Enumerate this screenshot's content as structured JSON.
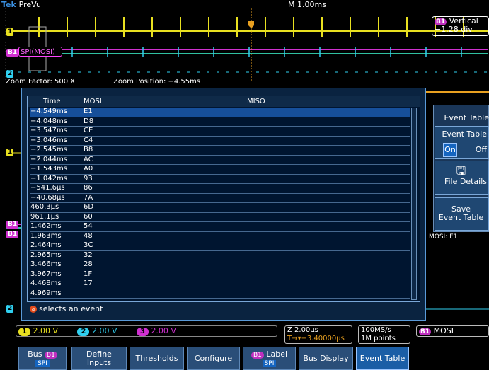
{
  "header": {
    "brand_prefix": "Tek",
    "brand_mode": "PreVu",
    "timebase": "M 1.00ms"
  },
  "zoom": {
    "factor_text": "Zoom Factor: 500 X",
    "position_text": "Zoom Position: −4.55ms"
  },
  "vertical_box": {
    "badge": "B1",
    "line1": "Vertical",
    "line2": "−1.28 div"
  },
  "bus_label": "SPI(MOSI)",
  "table": {
    "headers": {
      "time": "Time",
      "mosi": "MOSI",
      "miso": "MISO"
    },
    "rows": [
      {
        "time": "−4.549ms",
        "mosi": "E1"
      },
      {
        "time": "−4.048ms",
        "mosi": "D8"
      },
      {
        "time": "−3.547ms",
        "mosi": "CE"
      },
      {
        "time": "−3.046ms",
        "mosi": "C4"
      },
      {
        "time": "−2.545ms",
        "mosi": "B8"
      },
      {
        "time": "−2.044ms",
        "mosi": "AC"
      },
      {
        "time": "−1.543ms",
        "mosi": "A0"
      },
      {
        "time": "−1.042ms",
        "mosi": "93"
      },
      {
        "time": "−541.6µs",
        "mosi": "86"
      },
      {
        "time": "−40.68µs",
        "mosi": "7A"
      },
      {
        "time": "460.3µs",
        "mosi": "6D"
      },
      {
        "time": "961.1µs",
        "mosi": "60"
      },
      {
        "time": "1.462ms",
        "mosi": "54"
      },
      {
        "time": "1.963ms",
        "mosi": "48"
      },
      {
        "time": "2.464ms",
        "mosi": "3C"
      },
      {
        "time": "2.965ms",
        "mosi": "32"
      },
      {
        "time": "3.466ms",
        "mosi": "28"
      },
      {
        "time": "3.967ms",
        "mosi": "1F"
      },
      {
        "time": "4.468ms",
        "mosi": "17"
      },
      {
        "time": "4.969ms",
        "mosi": ""
      }
    ],
    "hint_knob": "a",
    "hint_text": "selects an event"
  },
  "side_menu": {
    "title": "Event Table",
    "toggle_label": "Event Table",
    "on_label": "On",
    "off_label": "Off",
    "file_details": "File Details",
    "save_line1": "Save",
    "save_line2": "Event Table",
    "mosi_readout": "MOSI: E1"
  },
  "status": {
    "ch1": "1",
    "ch1_value": "2.00 V",
    "ch2": "2",
    "ch2_value": "2.00 V",
    "ch3": "3",
    "ch3_value": "2.00 V",
    "zoom_time": "Z 2.00µs",
    "trigger": "T→▾−3.40000µs",
    "sample_rate": "100MS/s",
    "record_length": "1M points",
    "bus_badge": "B1",
    "bus_name": "MOSI"
  },
  "menu": {
    "bus_label": "Bus",
    "bus_badge": "B1",
    "bus_tag": "SPI",
    "define_inputs_1": "Define",
    "define_inputs_2": "Inputs",
    "thresholds": "Thresholds",
    "configure": "Configure",
    "label_badge": "B1",
    "label_text": "Label",
    "label_tag": "SPI",
    "bus_display": "Bus Display",
    "event_table": "Event Table"
  },
  "colors": {
    "ch1": "#e8e020",
    "ch2": "#30d0f0",
    "ch3": "#d030d0",
    "bus": "#30c0a0",
    "accent": "#1565c0"
  }
}
